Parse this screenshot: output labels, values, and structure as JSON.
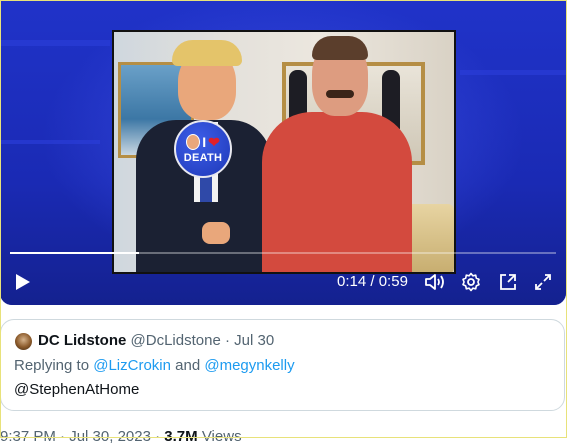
{
  "video": {
    "badge_text": "DEATH",
    "badge_heart": "❤",
    "badge_letter": "I",
    "progress": 0.237,
    "current_time": "0:14",
    "separator": "/",
    "duration": "0:59",
    "icons": [
      "play-icon",
      "volume-icon",
      "settings-icon",
      "picture-in-picture-icon",
      "fullscreen-icon"
    ]
  },
  "quoted_tweet": {
    "display_name": "DC Lidstone",
    "handle": "@DcLidstone",
    "dot": "·",
    "date": "Jul 30",
    "replying_prefix": "Replying to",
    "reply_mention_1": "@LizCrokin",
    "reply_and": "and",
    "reply_mention_2": "@megynkelly",
    "text": "@StephenAtHome"
  },
  "tweet_meta": {
    "time": "9:37 PM",
    "dot": "·",
    "date": "Jul 30, 2023",
    "views_count": "3.7M",
    "views_label": "Views"
  },
  "colors": {
    "video_bg": "#1e2fbf",
    "link": "#1d9bf0",
    "muted": "#536471"
  }
}
